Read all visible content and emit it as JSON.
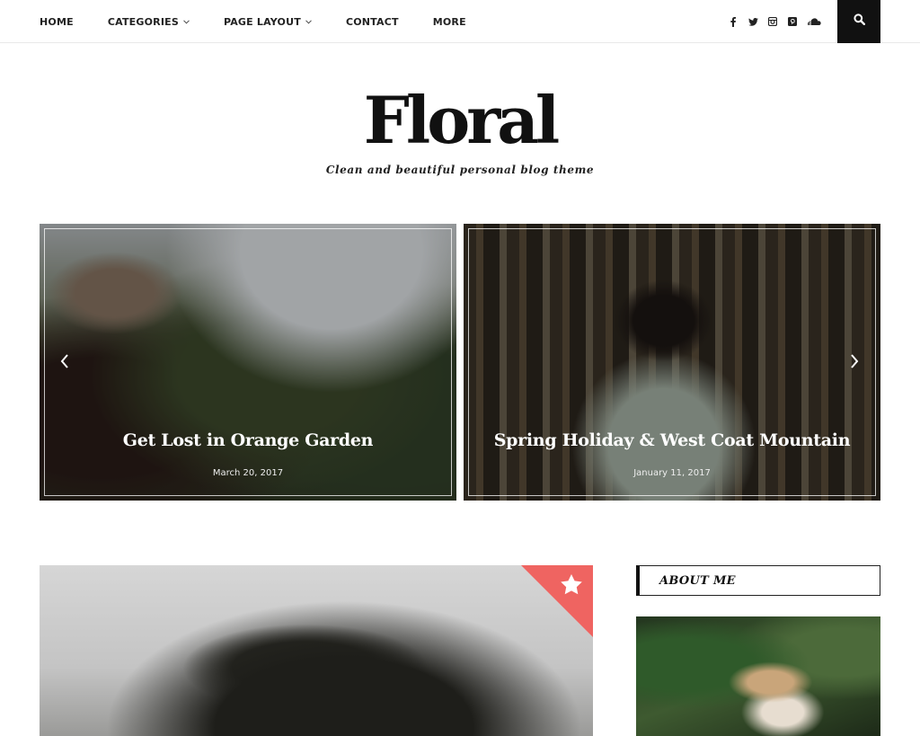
{
  "nav": {
    "items": [
      {
        "label": "HOME",
        "dropdown": false
      },
      {
        "label": "CATEGORIES",
        "dropdown": true
      },
      {
        "label": "PAGE LAYOUT",
        "dropdown": true
      },
      {
        "label": "CONTACT",
        "dropdown": false
      },
      {
        "label": "MORE",
        "dropdown": false
      }
    ],
    "dropdown_glyph": "⌄",
    "social": [
      "facebook-icon",
      "twitter-icon",
      "instagram-icon",
      "pinterest-icon",
      "soundcloud-icon"
    ],
    "search_icon": "search-icon"
  },
  "brand": {
    "logo": "Floral",
    "tagline": "Clean and beautiful personal blog theme"
  },
  "slider": {
    "slides": [
      {
        "title": "Get Lost in Orange Garden",
        "date": "March 20, 2017"
      },
      {
        "title": "Spring Holiday & West Coat Mountain",
        "date": "January 11, 2017"
      }
    ],
    "prev_icon": "chevron-left-icon",
    "next_icon": "chevron-right-icon"
  },
  "featured": {
    "badge_icon": "star-icon",
    "badge_color": "#ef6461"
  },
  "sidebar": {
    "about_title": "ABOUT ME"
  }
}
